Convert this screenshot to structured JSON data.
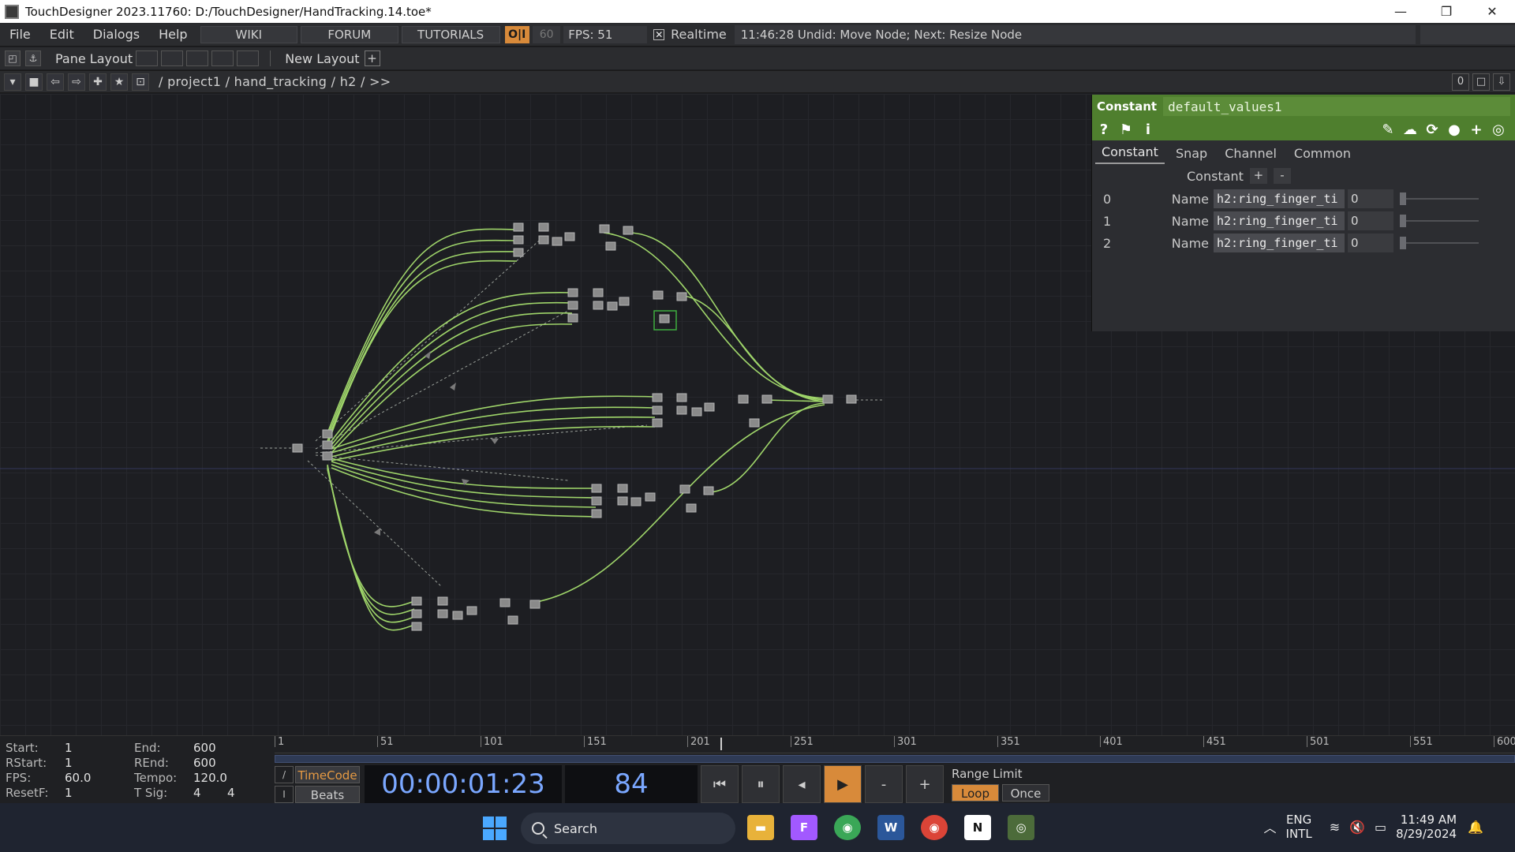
{
  "window": {
    "title": "TouchDesigner 2023.11760: D:/TouchDesigner/HandTracking.14.toe*",
    "minimize": "—",
    "restore": "❐",
    "close": "✕"
  },
  "menubar": {
    "file": "File",
    "edit": "Edit",
    "dialogs": "Dialogs",
    "help": "Help",
    "wiki": "WIKI",
    "forum": "FORUM",
    "tutorials": "TUTORIALS",
    "oi": "O|I",
    "fps_target": "60",
    "fps_label": "FPS:  51",
    "realtime_checked": "✕",
    "realtime": "Realtime",
    "status": "11:46:28 Undid: Move Node; Next: Resize Node"
  },
  "panebar": {
    "pane_layout": "Pane Layout",
    "new_layout": "New Layout",
    "add": "+"
  },
  "pathbar": {
    "path": "/ project1 / hand_tracking / h2 / >>",
    "counter": "0"
  },
  "params": {
    "op_type": "Constant",
    "op_name": "default_values1",
    "tabs": [
      "Constant",
      "Snap",
      "Channel",
      "Common"
    ],
    "section_label": "Constant",
    "add_btn": "+",
    "remove_btn": "-",
    "rows": [
      {
        "index": "0",
        "label": "Name",
        "name": "h2:ring_finger_ti",
        "value": "0"
      },
      {
        "index": "1",
        "label": "Name",
        "name": "h2:ring_finger_ti",
        "value": "0"
      },
      {
        "index": "2",
        "label": "Name",
        "name": "h2:ring_finger_ti",
        "value": "0"
      }
    ]
  },
  "timeline": {
    "start_label": "Start:",
    "start": "1",
    "end_label": "End:",
    "end": "600",
    "rstart_label": "RStart:",
    "rstart": "1",
    "rend_label": "REnd:",
    "rend": "600",
    "fps_label": "FPS:",
    "fps": "60.0",
    "tempo_label": "Tempo:",
    "tempo": "120.0",
    "resetf_label": "ResetF:",
    "resetf": "1",
    "tsig_label": "T Sig:",
    "tsig_a": "4",
    "tsig_b": "4",
    "ticks": [
      "1",
      "51",
      "101",
      "151",
      "201",
      "251",
      "301",
      "351",
      "401",
      "451",
      "501",
      "551",
      "600"
    ],
    "timecode": "TimeCode",
    "beats": "Beats",
    "time": "00:00:01:23",
    "frame": "84",
    "range_limit": "Range Limit",
    "loop": "Loop",
    "once": "Once",
    "minus": "-",
    "plus": "+"
  },
  "taskbar": {
    "search": "Search",
    "lang_top": "ENG",
    "lang_bottom": "INTL",
    "time": "11:49 AM",
    "date": "8/29/2024"
  },
  "colors": {
    "wire": "#9fd56a",
    "op_header": "#4f7f2e",
    "accent_orange": "#d88a3a",
    "timecode_blue": "#7aa7ff"
  }
}
